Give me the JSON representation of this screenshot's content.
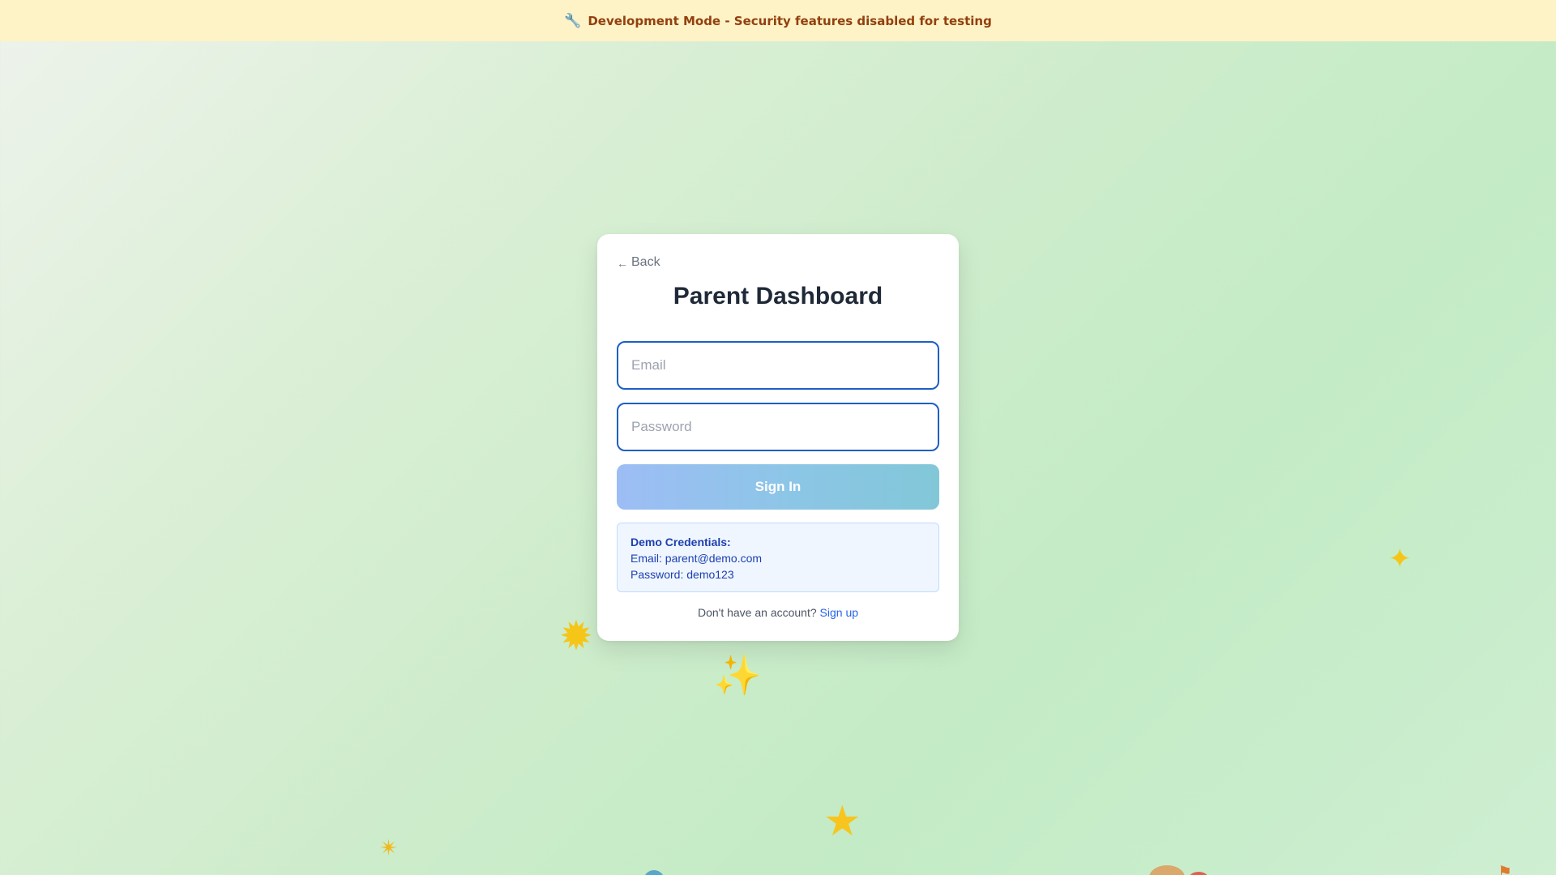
{
  "banner": {
    "icon": "wrench-icon",
    "text": "Development Mode - Security features disabled for testing"
  },
  "login": {
    "back_label": "Back",
    "title": "Parent Dashboard",
    "email_placeholder": "Email",
    "email_value": "",
    "password_placeholder": "Password",
    "password_value": "",
    "sign_in_label": "Sign In",
    "demo": {
      "title": "Demo Credentials:",
      "email_line": "Email: parent@demo.com",
      "password_line": "Password: demo123"
    },
    "signup_prompt": "Don't have an account?",
    "signup_link": "Sign up"
  },
  "decorations": [
    "glowing-star-icon",
    "sparkles-icon",
    "star-icon",
    "sparkle-icon",
    "dizzy-icon",
    "globe-icon",
    "palette-icon",
    "balloon-icon",
    "flag-icon"
  ],
  "colors": {
    "banner_bg": "#fef3c7",
    "banner_text": "#92400e",
    "input_border": "#1d5fc4",
    "button_gradient_start": "#9dbdf5",
    "button_gradient_end": "#82c7d8",
    "link": "#2563eb",
    "demo_text": "#1e40af"
  }
}
